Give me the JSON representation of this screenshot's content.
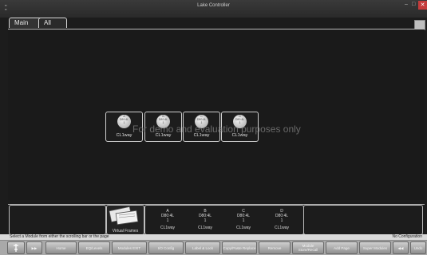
{
  "window": {
    "title": "Lake Controller",
    "app_icon": "lake-app-icon",
    "minimize": "–",
    "maximize": "□",
    "close": "✕"
  },
  "tabs": [
    {
      "label": "Main"
    },
    {
      "label": "All"
    }
  ],
  "watermark": "For demo and evaluation purposes only",
  "modules": [
    {
      "letter": "A",
      "model": "D80:4L",
      "index": "1",
      "name": "CL1way"
    },
    {
      "letter": "B",
      "model": "D80:4L",
      "index": "1",
      "name": "CL1way"
    },
    {
      "letter": "C",
      "model": "D80:4L",
      "index": "1",
      "name": "CL1way"
    },
    {
      "letter": "D",
      "model": "D80:4L",
      "index": "1",
      "name": "CL1way"
    }
  ],
  "scrollbar": {
    "virtual_frames_label": "Virtual Frames",
    "items": [
      {
        "letter": "A",
        "model": "D80:4L",
        "index": "1",
        "name": "CL1way"
      },
      {
        "letter": "B",
        "model": "D80:4L",
        "index": "1",
        "name": "CL1way"
      },
      {
        "letter": "C",
        "model": "D80:4L",
        "index": "1",
        "name": "CL1way"
      },
      {
        "letter": "D",
        "model": "D80:4L",
        "index": "1",
        "name": "CL1way"
      }
    ]
  },
  "status": {
    "left": "Select a Module from either the scrolling bar or the page",
    "right": "No Configuration"
  },
  "toolbar": [
    {
      "label": "",
      "icon": "pin-icon"
    },
    {
      "label": "▶▶",
      "icon": "fast-forward-icon"
    },
    {
      "label": "Home"
    },
    {
      "label": "EQ/Levels"
    },
    {
      "label": "Modules EXIT"
    },
    {
      "label": "I/O Config"
    },
    {
      "label": "Label & Lock"
    },
    {
      "label": "Copy/Paste Replace"
    },
    {
      "label": "Remove"
    },
    {
      "label": "Module Store/Recall"
    },
    {
      "label": "Add Page"
    },
    {
      "label": "Super Modules"
    },
    {
      "label": "◀◀",
      "icon": "rewind-icon"
    },
    {
      "label": "Undo"
    }
  ]
}
